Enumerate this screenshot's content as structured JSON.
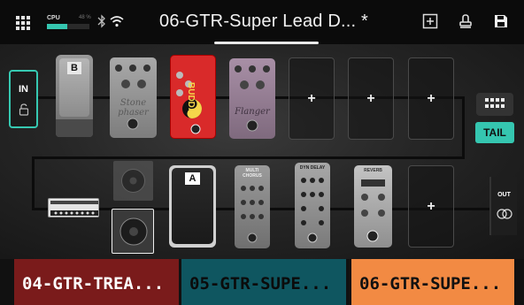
{
  "topbar": {
    "cpu_label": "CPU",
    "cpu_percent_text": "48 %",
    "cpu_load": 0.48,
    "preset_title": "06-GTR-Super Lead D... *",
    "icons": [
      "grid-menu-icon",
      "bluetooth-icon",
      "wifi-icon",
      "add-block-icon",
      "tuner-icon",
      "save-icon"
    ]
  },
  "signal_chain": {
    "input_label": "IN",
    "tail_label": "TAIL",
    "output_label": "OUT",
    "empty_slot_label": "+",
    "row1": [
      {
        "type": "wah",
        "tag": "B"
      },
      {
        "type": "phaser",
        "text": "Stone phaser"
      },
      {
        "type": "overdrive",
        "text": "BUDDA"
      },
      {
        "type": "flanger",
        "text": "Flanger"
      },
      {
        "type": "empty"
      },
      {
        "type": "empty"
      },
      {
        "type": "empty"
      }
    ],
    "row2": [
      {
        "type": "amp"
      },
      {
        "type": "cab"
      },
      {
        "type": "volume",
        "tag": "A"
      },
      {
        "type": "chorus",
        "text": "MULTI CHORUS"
      },
      {
        "type": "delay",
        "text": "DYN DELAY"
      },
      {
        "type": "reverb",
        "text": "REVERB"
      },
      {
        "type": "empty"
      }
    ]
  },
  "presets": [
    {
      "label": "04-GTR-TREA...",
      "color": "#7a1b1b",
      "text_color": "#ffffff"
    },
    {
      "label": "05-GTR-SUPE...",
      "color": "#0f5660",
      "text_color": "#0b0b0b"
    },
    {
      "label": "06-GTR-SUPE...",
      "color": "#f28a43",
      "text_color": "#111111"
    }
  ],
  "colors": {
    "accent": "#35c6b0",
    "overdrive_red": "#d92a2a",
    "background": "#111111"
  }
}
